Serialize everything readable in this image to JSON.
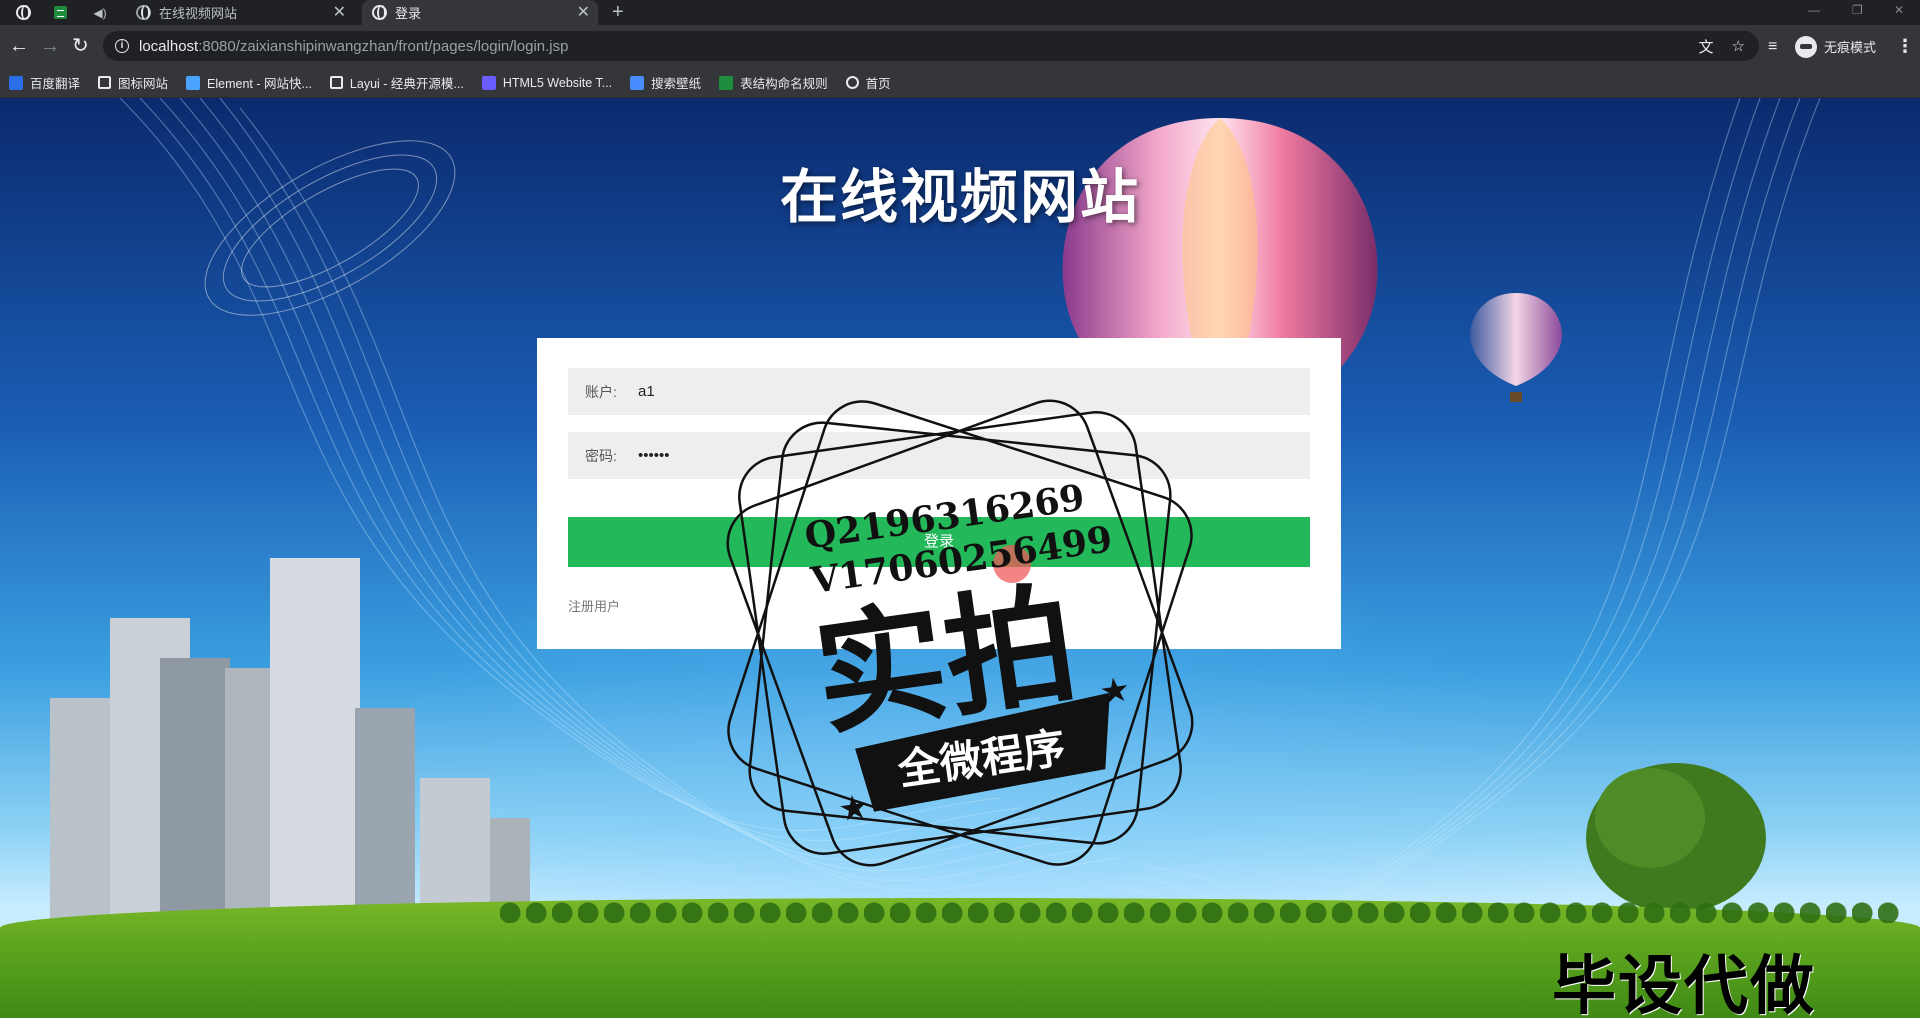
{
  "browser": {
    "tabs": [
      {
        "title": "在线视频网站",
        "active": false
      },
      {
        "title": "登录",
        "active": true
      }
    ],
    "new_tab_label": "+",
    "close_glyph": "✕",
    "url_host": "localhost",
    "url_path": ":8080/zaixianshipinwangzhan/front/pages/login/login.jsp",
    "profile_label": "无痕模式",
    "bookmarks": [
      {
        "label": "百度翻译",
        "icon": "translate-icon",
        "color": "#2a6ee8"
      },
      {
        "label": "图标网站",
        "icon": "flag-icon",
        "color": "#e8eaed"
      },
      {
        "label": "Element - 网站快...",
        "icon": "element-icon",
        "color": "#4aa3ff"
      },
      {
        "label": "Layui - 经典开源模...",
        "icon": "layui-icon",
        "color": "#e8eaed"
      },
      {
        "label": "HTML5 Website T...",
        "icon": "html5-icon",
        "color": "#6a5cff"
      },
      {
        "label": "搜索壁纸",
        "icon": "wallpaper-icon",
        "color": "#4a8cff"
      },
      {
        "label": "表结构命名规则",
        "icon": "sheet-icon",
        "color": "#1e8e3e"
      },
      {
        "label": "首页",
        "icon": "globe-icon",
        "color": "#e8eaed"
      }
    ]
  },
  "page": {
    "title": "在线视频网站",
    "account_label": "账户:",
    "account_value": "a1",
    "password_label": "密码:",
    "password_value": "••••••",
    "login_button": "登录",
    "register_link": "注册用户"
  },
  "overlay": {
    "stamp_line1": "Q2196316269",
    "stamp_line2": "V17060256499",
    "stamp_big": "实拍",
    "stamp_ribbon": "全微程序",
    "watermark": "毕设代做"
  },
  "colors": {
    "login_button": "#23b85a",
    "chrome_dark": "#202124",
    "chrome_toolbar": "#35363a"
  }
}
